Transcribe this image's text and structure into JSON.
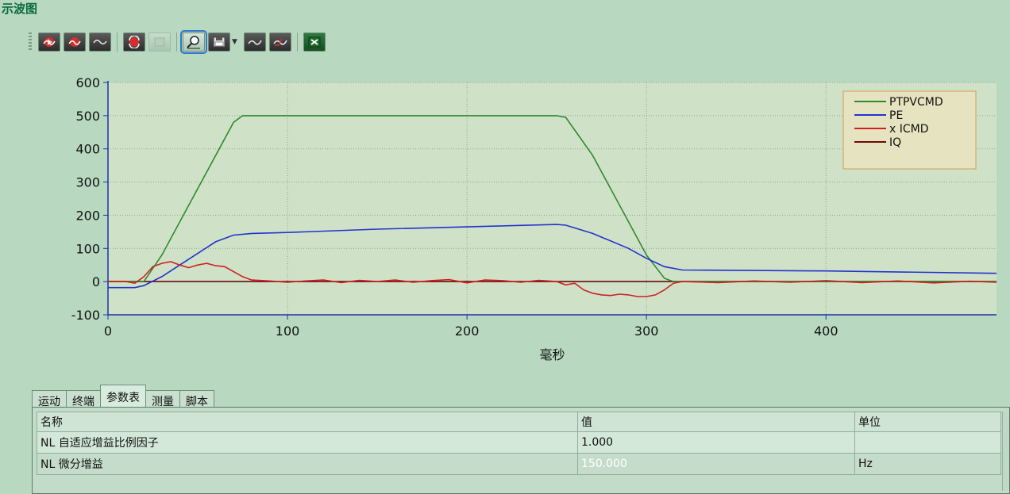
{
  "window": {
    "title": "示波图"
  },
  "toolbar": {
    "buttons": [
      {
        "name": "start-capture-button",
        "icon": "play-wave-icon"
      },
      {
        "name": "stop-capture-button",
        "icon": "stop-wave-icon"
      },
      {
        "name": "single-capture-button",
        "icon": "wave-icon"
      },
      {
        "name": "refresh-button",
        "icon": "refresh-wave-icon"
      },
      {
        "name": "disabled-button",
        "icon": "blank-icon"
      },
      {
        "name": "zoom-button",
        "icon": "magnifier-icon"
      },
      {
        "name": "save-button",
        "icon": "floppy-icon"
      },
      {
        "name": "overlay-button",
        "icon": "wave-compare-icon"
      },
      {
        "name": "trigger-button",
        "icon": "wave-trigger-icon"
      },
      {
        "name": "export-excel-button",
        "icon": "excel-icon"
      }
    ]
  },
  "chart_data": {
    "type": "line",
    "xlabel": "毫秒",
    "ylabel": "",
    "xlim": [
      0,
      495
    ],
    "ylim": [
      -100,
      600
    ],
    "xticks": [
      0,
      100,
      200,
      300,
      400
    ],
    "yticks": [
      -100,
      0,
      100,
      200,
      300,
      400,
      500,
      600
    ],
    "grid": true,
    "legend_position": "top-right",
    "series": [
      {
        "name": "PTPVCMD",
        "color": "#2f8a2f",
        "x": [
          0,
          20,
          30,
          50,
          70,
          75,
          250,
          255,
          270,
          290,
          300,
          310,
          315,
          495
        ],
        "y": [
          0,
          0,
          80,
          280,
          480,
          500,
          500,
          495,
          380,
          180,
          80,
          10,
          0,
          0
        ]
      },
      {
        "name": "PE",
        "color": "#2233cc",
        "x": [
          0,
          15,
          20,
          30,
          40,
          50,
          60,
          70,
          80,
          100,
          150,
          200,
          250,
          255,
          270,
          290,
          300,
          310,
          320,
          400,
          495
        ],
        "y": [
          -18,
          -18,
          -12,
          15,
          50,
          85,
          120,
          140,
          145,
          148,
          158,
          165,
          172,
          170,
          145,
          100,
          70,
          45,
          35,
          32,
          25
        ]
      },
      {
        "name": "x ICMD",
        "color": "#d02020",
        "x": [
          0,
          10,
          15,
          20,
          25,
          30,
          35,
          40,
          45,
          50,
          55,
          60,
          65,
          70,
          75,
          80,
          90,
          100,
          110,
          120,
          130,
          140,
          150,
          160,
          170,
          180,
          190,
          200,
          210,
          220,
          230,
          240,
          250,
          255,
          260,
          265,
          270,
          275,
          280,
          285,
          290,
          295,
          300,
          305,
          310,
          315,
          320,
          340,
          360,
          380,
          400,
          420,
          440,
          460,
          480,
          495
        ],
        "y": [
          0,
          0,
          -5,
          15,
          45,
          55,
          60,
          50,
          42,
          50,
          55,
          48,
          45,
          30,
          15,
          5,
          2,
          -2,
          2,
          5,
          -3,
          4,
          0,
          5,
          -2,
          3,
          6,
          -4,
          5,
          3,
          -2,
          4,
          0,
          -10,
          -5,
          -25,
          -35,
          -40,
          -42,
          -38,
          -40,
          -45,
          -45,
          -40,
          -25,
          -5,
          0,
          -3,
          2,
          -2,
          3,
          -3,
          2,
          -4,
          1,
          -2
        ]
      },
      {
        "name": "IQ",
        "color": "#6a0a0a",
        "x": [
          0,
          495
        ],
        "y": [
          0,
          0
        ]
      }
    ]
  },
  "tabs": [
    {
      "label": "运动",
      "active": false
    },
    {
      "label": "终端",
      "active": false
    },
    {
      "label": "参数表",
      "active": true
    },
    {
      "label": "测量",
      "active": false
    },
    {
      "label": "脚本",
      "active": false
    }
  ],
  "params_table": {
    "headers": {
      "name": "名称",
      "value": "值",
      "unit": "单位"
    },
    "rows": [
      {
        "name": "NL 自适应增益比例因子",
        "value": "1.000",
        "unit": "",
        "selected": false
      },
      {
        "name": "NL 微分增益",
        "value": "150.000",
        "unit": "Hz",
        "selected": true
      }
    ]
  }
}
